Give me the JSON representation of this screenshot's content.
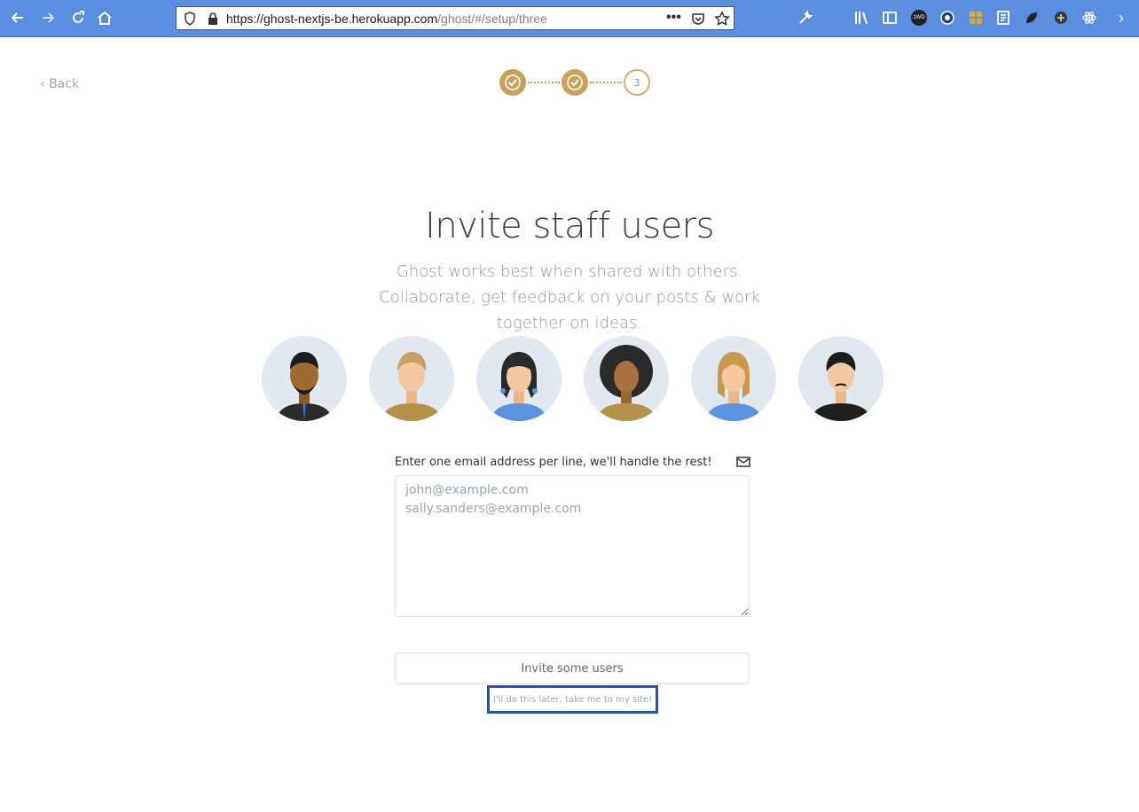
{
  "browser": {
    "url_host": "https://ghost-nextjs-be.herokuapp.com",
    "url_path": "/ghost/#/setup/three",
    "ext_badge": "1WD"
  },
  "page": {
    "back_label": "Back",
    "steps": [
      {
        "state": "done"
      },
      {
        "state": "done"
      },
      {
        "state": "current",
        "label": "3"
      }
    ],
    "title": "Invite staff users",
    "subtitle": "Ghost works best when shared with others. Collaborate, get feedback on your posts & work together on ideas.",
    "email_hint": "Enter one email address per line, we'll handle the rest!",
    "email_placeholder": "john@example.com\nsally.sanders@example.com",
    "invite_button": "Invite some users",
    "skip_link": "I'll do this later, take me to my site!"
  },
  "colors": {
    "accent": "#c9a258",
    "toolbar": "#5a8fe0",
    "focus_outline": "#2054b3"
  }
}
